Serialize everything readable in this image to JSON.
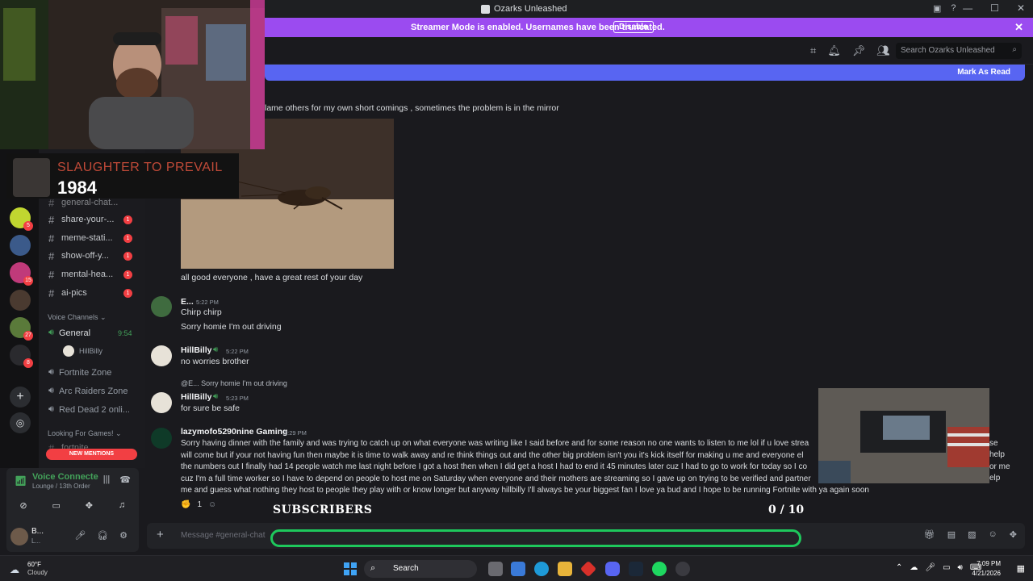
{
  "window": {
    "title": "Ozarks Unleashed"
  },
  "banner": {
    "text": "Streamer Mode is enabled. Usernames have been truncated.",
    "disable_label": "Disable"
  },
  "header": {
    "search_placeholder": "Search Ozarks Unleashed"
  },
  "markbar": {
    "label": "Mark As Read"
  },
  "overlay": {
    "follower_label": "SLAUGHTER TO PREVAIL",
    "follower_count": "1984",
    "subs_label": "SUBSCRIBERS",
    "subs_count": "0 / 10"
  },
  "channels": {
    "partial": "general-chat...",
    "items": [
      {
        "name": "share-your-...",
        "count": "1"
      },
      {
        "name": "meme-stati...",
        "count": "1"
      },
      {
        "name": "show-off-y...",
        "count": "1"
      },
      {
        "name": "mental-hea...",
        "count": "1"
      },
      {
        "name": "ai-pics",
        "count": "1"
      }
    ],
    "voice_category": "Voice Channels",
    "voice": [
      {
        "name": "General",
        "time": "9:54"
      },
      {
        "name": "HillBilly"
      },
      {
        "name": "Fortnite Zone"
      },
      {
        "name": "Arc Raiders Zone"
      },
      {
        "name": "Red Dead 2 onli..."
      }
    ],
    "lfg_category": "Looking For Games!",
    "lfg_partial": "fortnite",
    "mentions_label": "NEW MENTIONS"
  },
  "servers": {
    "badges": [
      "5",
      "15",
      "27",
      "8"
    ]
  },
  "voice_panel": {
    "status": "Voice Connecte",
    "sub": "Lounge / 13th Order"
  },
  "user_panel": {
    "name": "B...",
    "status": "L..."
  },
  "messages": {
    "m0_text": "lame others for my own short comings , sometimes the problem is in the mirror",
    "m0_after": "all good everyone , have a great rest of your day",
    "m1": {
      "user": "E...",
      "time": "5:22 PM",
      "lines": [
        "Chirp chirp",
        "Sorry homie I'm out driving"
      ]
    },
    "m2": {
      "user": "HillBilly",
      "time": "5:22 PM",
      "line": "no worries brother"
    },
    "m3": {
      "reply_user": "@E...",
      "reply_text": "Sorry homie I'm out driving",
      "user": "HillBilly",
      "time": "5:23 PM",
      "line": "for sure be safe"
    },
    "m4": {
      "user": "lazymofo5290nine Gaming",
      "time": "5:29 PM",
      "lines": [
        "Sorry having dinner with the family and was trying to catch up on what everyone was writing like I said before and for some reason no one wants to listen to me lol if u love strea",
        "will come but if your not having fun then maybe it is time to walk away and re think things out and the other big problem isn't you it's kick itself for making u me and everyone el",
        "the numbers out I finally had 14 people watch me last night before I got a host then when I did get a host I had to end it 45 minutes later cuz I had to go to work for today so I co",
        "cuz I'm a full time worker so I have to depend on people to host me on Saturday when everyone and their mothers are streaming so I gave up on trying to be verified and partner",
        "me and guess what nothing they host to people they play with or know longer but anyway hillbilly I'll always be your biggest fan I love ya bud and I hope to be running Fortnite with ya again soon"
      ],
      "tails": [
        "se",
        "help",
        "or me",
        "elp"
      ],
      "reaction_count": "1"
    }
  },
  "input": {
    "placeholder": "Message #general-chat"
  },
  "taskbar": {
    "temp": "60°F",
    "weather": "Cloudy",
    "search": "Search",
    "time": "7:09 PM",
    "date": "4/21/2026"
  },
  "colors": {
    "accent": "#5865f2",
    "banner": "#9b4bf0",
    "green": "#1ec85c",
    "danger": "#f23f43"
  }
}
